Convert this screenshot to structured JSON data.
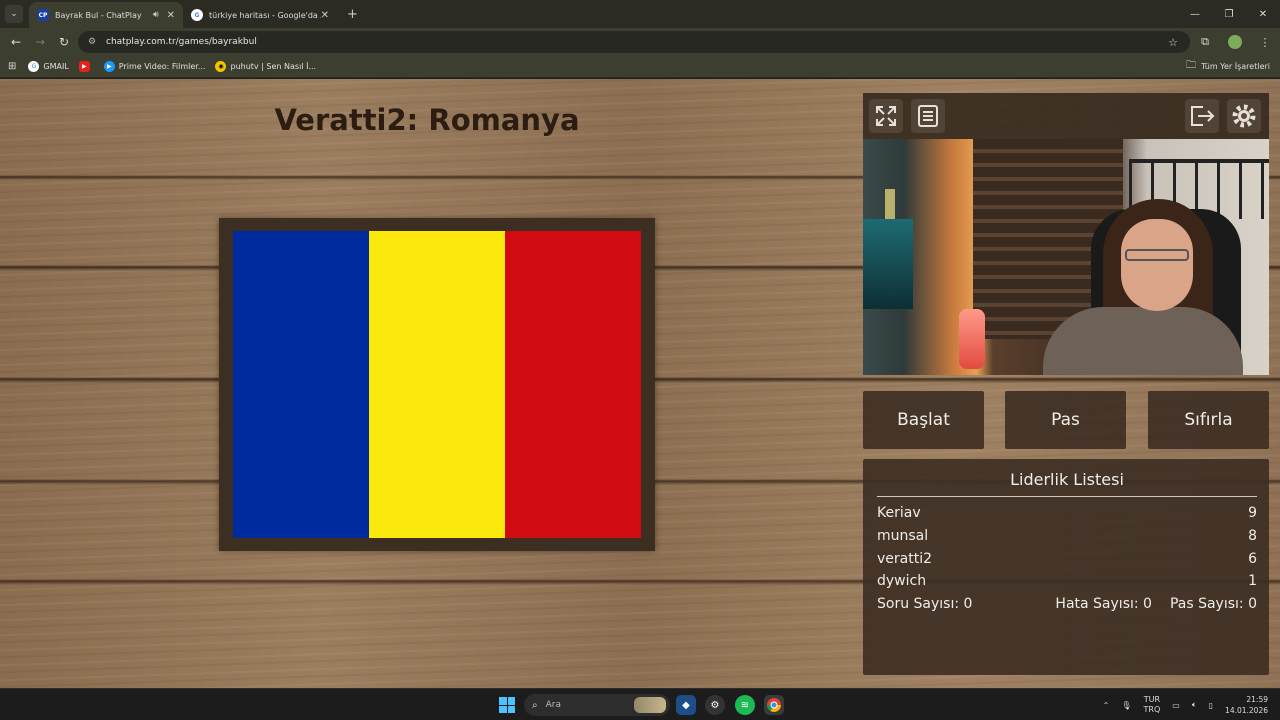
{
  "browser": {
    "tabs": [
      {
        "favicon": "CP",
        "title": "Bayrak Bul - ChatPlay",
        "audio_icon": "speaker-icon",
        "active": true
      },
      {
        "favicon": "G",
        "title": "türkiye haritası - Google'da Ara",
        "active": false
      }
    ],
    "url": "chatplay.com.tr/games/bayrakbul",
    "bookmarks": [
      {
        "label": "GMAIL",
        "icon": "google-icon",
        "color": "#ffffff"
      },
      {
        "label": "",
        "icon": "youtube-icon",
        "color": "#e62117"
      },
      {
        "label": "Prime Video: Filmler...",
        "icon": "prime-video-icon",
        "color": "#1a98ff"
      },
      {
        "label": "puhutv | Sen Nasıl İ...",
        "icon": "puhutv-icon",
        "color": "#f5c400"
      }
    ],
    "all_bookmarks_label": "Tüm Yer İşaretleri"
  },
  "game": {
    "title": "Veratti2: Romanya",
    "flag_colors": [
      "#002b9e",
      "#fbe80d",
      "#d00c12"
    ],
    "buttons": {
      "start": "Başlat",
      "pass": "Pas",
      "reset": "Sıfırla"
    },
    "leaderboard": {
      "title": "Liderlik Listesi",
      "entries": [
        {
          "name": "Keriav",
          "score": "9"
        },
        {
          "name": "munsal",
          "score": "8"
        },
        {
          "name": "veratti2",
          "score": "6"
        },
        {
          "name": "dywich",
          "score": "1"
        }
      ],
      "stats": {
        "questions": "Soru Sayısı: 0",
        "errors": "Hata Sayısı: 0",
        "passes": "Pas Sayısı: 0"
      }
    }
  },
  "taskbar": {
    "search_placeholder": "Ara",
    "language_top": "TUR",
    "language_bottom": "TRQ",
    "time": "21:59",
    "date": "14.01.2026"
  }
}
